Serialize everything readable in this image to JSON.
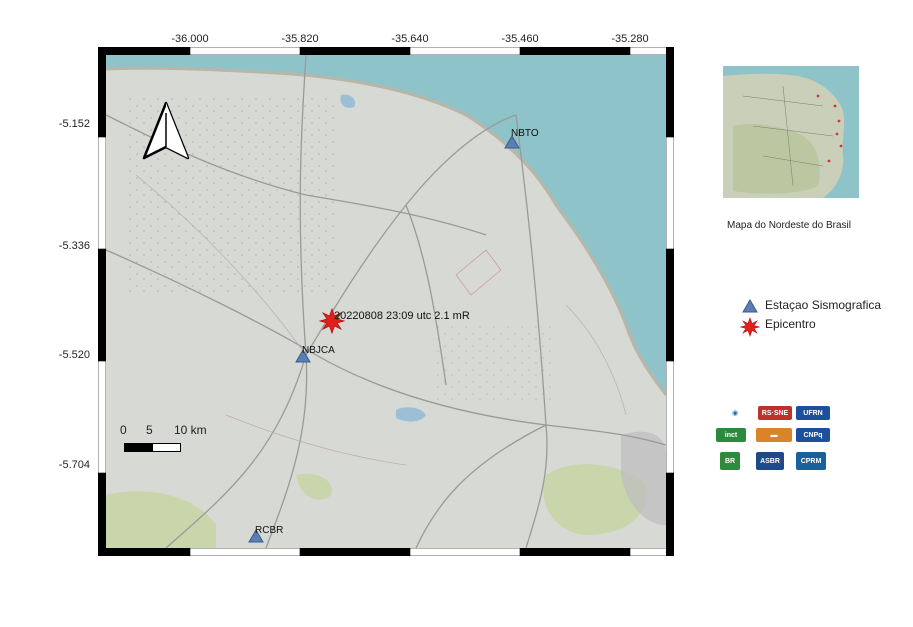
{
  "map": {
    "x_ticks": [
      "-36.000",
      "-35.820",
      "-35.640",
      "-35.460",
      "-35.280"
    ],
    "y_ticks": [
      "-5.152",
      "-5.336",
      "-5.520",
      "-5.704"
    ],
    "event_label": "20220808 23:09 utc 2.1 mR",
    "stations": [
      {
        "code": "NBTO"
      },
      {
        "code": "NBJCA"
      },
      {
        "code": "RCBR"
      }
    ],
    "scale_bar": {
      "labels": [
        "0",
        "5",
        "10 km"
      ]
    }
  },
  "inset": {
    "caption": "Mapa do Nordeste do  Brasil"
  },
  "legend": {
    "station_label": "Estaçao Sismografica",
    "epicenter_label": "Epicentro"
  },
  "logos": [
    {
      "name": "LabSis UFRN",
      "color": "#1b6fa8"
    },
    {
      "name": "RSISNE",
      "color": "#c0312b"
    },
    {
      "name": "UFRN",
      "color": "#1c4f9c"
    },
    {
      "name": "Inct",
      "color": "#2b8a3e"
    },
    {
      "name": "Petrobras bar",
      "color": "#d9832b"
    },
    {
      "name": "CNPq",
      "color": "#1c4f9c"
    },
    {
      "name": "BR",
      "color": "#2e8b3d"
    },
    {
      "name": "ASBR",
      "color": "#1f4a8a"
    },
    {
      "name": "CPRM",
      "color": "#1a5f9e"
    }
  ]
}
